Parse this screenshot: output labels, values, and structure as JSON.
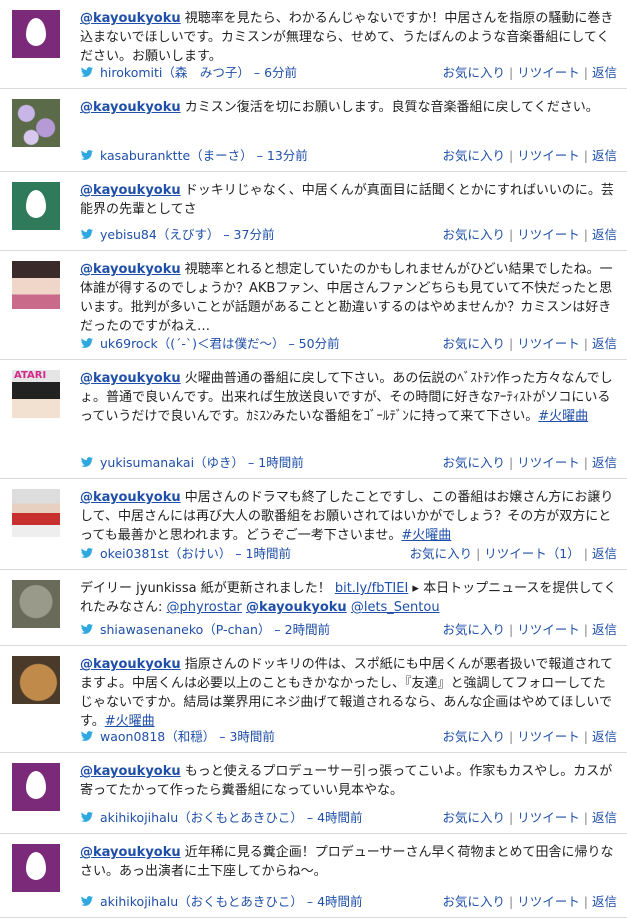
{
  "tweets": [
    {
      "avatar": "egg-purple",
      "segments": [
        {
          "t": "mention",
          "v": "@kayoukyoku"
        },
        {
          "t": "text",
          "v": " 視聴率を見たら、わかるんじゃないですか！中居さんを指原の騒動に巻き込まないでほしいです。カミスンが無理なら、せめて、うたばんのような音楽番組にしてください。お願いします。"
        }
      ],
      "user": "hirokomiti（森　みつ子）",
      "time": "6分前",
      "actions": [
        "お気に入り",
        "リツイート",
        "返信"
      ]
    },
    {
      "avatar": "photo-flowers",
      "segments": [
        {
          "t": "mention",
          "v": "@kayoukyoku"
        },
        {
          "t": "text",
          "v": " カミスン復活を切にお願いします。良質な音楽番組に戻してください。"
        }
      ],
      "user": "kasaburanktte（まーさ）",
      "time": "13分前",
      "actions": [
        "お気に入り",
        "リツイート",
        "返信"
      ]
    },
    {
      "avatar": "egg-teal",
      "segments": [
        {
          "t": "mention",
          "v": "@kayoukyoku"
        },
        {
          "t": "text",
          "v": " ドッキリじゃなく、中居くんが真面目に話聞くとかにすればいいのに。芸能界の先輩としてさ"
        }
      ],
      "user": "yebisu84（えびす）",
      "time": "37分前",
      "actions": [
        "お気に入り",
        "リツイート",
        "返信"
      ]
    },
    {
      "avatar": "photo-girl",
      "segments": [
        {
          "t": "mention",
          "v": "@kayoukyoku"
        },
        {
          "t": "text",
          "v": " 視聴率とれると想定していたのかもしれませんがひどい結果でしたね。一体誰が得するのでしょうか？AKBファン、中居さんファンどちらも見ていて不快だったと思います。批判が多いことが話題があることと勘違いするのはやめませんか？カミスンは好きだったのですがねえ…"
        }
      ],
      "user": "uk69rock（(´-`)＜君は僕だ〜）",
      "time": "50分前",
      "actions": [
        "お気に入り",
        "リツイート",
        "返信"
      ]
    },
    {
      "avatar": "photo-atari",
      "avatar_text": "ATARI",
      "segments": [
        {
          "t": "mention",
          "v": "@kayoukyoku"
        },
        {
          "t": "text",
          "v": " 火曜曲普通の番組に戻して下さい。あの伝説のﾍﾞｽﾄﾃﾝ作った方々なんでしょ。普通で良いんです。出来れば生放送良いですが、その時間に好きなｱｰﾃｨｽﾄがソコにいるっていうだけで良いんです。ｶﾐｽﾝみたいな番組をｺﾞｰﾙﾃﾞﾝに持って来て下さい。"
        },
        {
          "t": "link",
          "v": "#火曜曲"
        }
      ],
      "user": "yukisumanakai（ゆき）",
      "time": "1時間前",
      "actions": [
        "お気に入り",
        "リツイート",
        "返信"
      ]
    },
    {
      "avatar": "photo-kids",
      "segments": [
        {
          "t": "mention",
          "v": "@kayoukyoku"
        },
        {
          "t": "text",
          "v": " 中居さんのドラマも終了したことですし、この番組はお嬢さん方にお譲りして、中居さんには再び大人の歌番組をお願いされてはいかがでしょう？その方が双方にとっても最善かと思われます。どうぞご一考下さいませ。"
        },
        {
          "t": "link",
          "v": "#火曜曲"
        }
      ],
      "user": "okei0381st（おけい）",
      "time": "1時間前",
      "actions": [
        "お気に入り",
        "リツイート（1）",
        "返信"
      ]
    },
    {
      "avatar": "photo-cat",
      "segments": [
        {
          "t": "text",
          "v": "デイリー jyunkissa 紙が更新されました！ "
        },
        {
          "t": "link",
          "v": "bit.ly/fbTIEI"
        },
        {
          "t": "text",
          "v": " ▸ 本日トップニュースを提供してくれたみなさん: "
        },
        {
          "t": "link",
          "v": "@phyrostar"
        },
        {
          "t": "text",
          "v": " "
        },
        {
          "t": "mention",
          "v": "@kayoukyoku"
        },
        {
          "t": "text",
          "v": " "
        },
        {
          "t": "link",
          "v": "@lets_Sentou"
        }
      ],
      "user": "shiawasenaneko（P-chan）",
      "time": "2時間前",
      "actions": [
        "お気に入り",
        "リツイート",
        "返信"
      ]
    },
    {
      "avatar": "photo-dog",
      "segments": [
        {
          "t": "mention",
          "v": "@kayoukyoku"
        },
        {
          "t": "text",
          "v": " 指原さんのドッキリの件は、スポ紙にも中居くんが悪者扱いで報道されてますよ。中居くんは必要以上のこともきかなかったし、『友達』と強調してフォローしてたじゃないですか。結局は業界用にネジ曲げて報道されるなら、あんな企画はやめてほしいです。"
        },
        {
          "t": "link",
          "v": "#火曜曲"
        }
      ],
      "user": "waon0818（和穏）",
      "time": "3時間前",
      "actions": [
        "お気に入り",
        "リツイート",
        "返信"
      ]
    },
    {
      "avatar": "egg-purple",
      "segments": [
        {
          "t": "mention",
          "v": "@kayoukyoku"
        },
        {
          "t": "text",
          "v": " もっと使えるプロデューサー引っ張ってこいよ。作家もカスやし。カスが寄ってたかって作ったら糞番組になっていい見本やな。"
        }
      ],
      "user": "akihikojihalu（おくもとあきひこ）",
      "time": "4時間前",
      "actions": [
        "お気に入り",
        "リツイート",
        "返信"
      ]
    },
    {
      "avatar": "egg-purple",
      "segments": [
        {
          "t": "mention",
          "v": "@kayoukyoku"
        },
        {
          "t": "text",
          "v": " 近年稀に見る糞企画！プロデューサーさん早く荷物まとめて田舎に帰りなさい。あっ出演者に土下座してからね〜。"
        }
      ],
      "user": "akihikojihalu（おくもとあきひこ）",
      "time": "4時間前",
      "actions": [
        "お気に入り",
        "リツイート",
        "返信"
      ]
    }
  ],
  "colors": {
    "link": "#1f4fa8",
    "bird": "#2fa8e0",
    "separator": "#d9d9d9"
  },
  "icons": {
    "bird": "twitter-bird-icon",
    "egg": "default-egg-avatar"
  }
}
